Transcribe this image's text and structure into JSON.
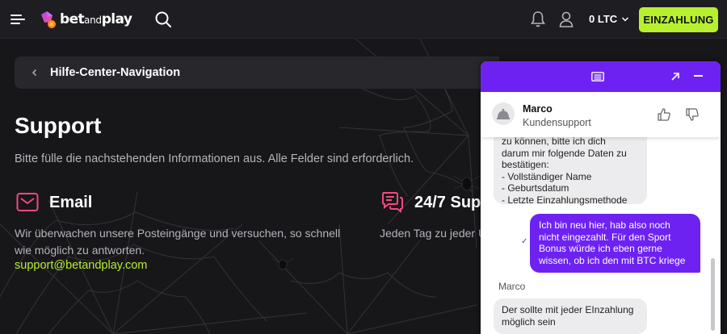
{
  "header": {
    "logo_main": "bet",
    "logo_small": "and",
    "logo_end": "play",
    "balance": "0 LTC",
    "deposit_label": "EINZAHLUNG",
    "icons": [
      "menu-icon",
      "search-icon",
      "bell-icon",
      "user-icon",
      "chevron-down-icon"
    ]
  },
  "breadcrumb": {
    "label": "Hilfe-Center-Navigation"
  },
  "page": {
    "title": "Support",
    "subtitle": "Bitte fülle die nachstehenden Informationen aus. Alle Felder sind erforderlich."
  },
  "cards": {
    "email": {
      "title": "Email",
      "desc_line1": "Wir überwachen unsere Posteingänge und versuchen, so schnell",
      "desc_line2": "wie möglich zu antworten.",
      "link": "support@betandplay.com"
    },
    "chat": {
      "title": "24/7 Sup",
      "desc": "Jeden Tag zu jeder U"
    }
  },
  "chat_widget": {
    "agent_name": "Marco",
    "agent_role": "Kundensupport",
    "messages": {
      "agent_1": [
        "zu können, bitte ich dich",
        "darum mir folgende Daten zu",
        "bestätigen:",
        "- Vollständiger Name",
        "- Geburtsdatum",
        "- Letzte Einzahlungsmethode"
      ],
      "user_1": [
        "Ich bin neu hier, hab also noch",
        "nicht eingezahlt. Für den Sport",
        "Bonus würde ich eben gerne",
        "wissen, ob ich den mit BTC kriege"
      ],
      "sender_2": "Marco",
      "agent_2": [
        "Der sollte mit jeder EInzahlung",
        "möglich sein"
      ]
    },
    "colors": {
      "header": "#6e22f2",
      "user_bubble": "#6e22f2",
      "agent_bubble": "#ececee"
    }
  },
  "colors": {
    "accent": "#b8f02f",
    "icon_pink": "#f2497e",
    "background": "#17171a"
  }
}
